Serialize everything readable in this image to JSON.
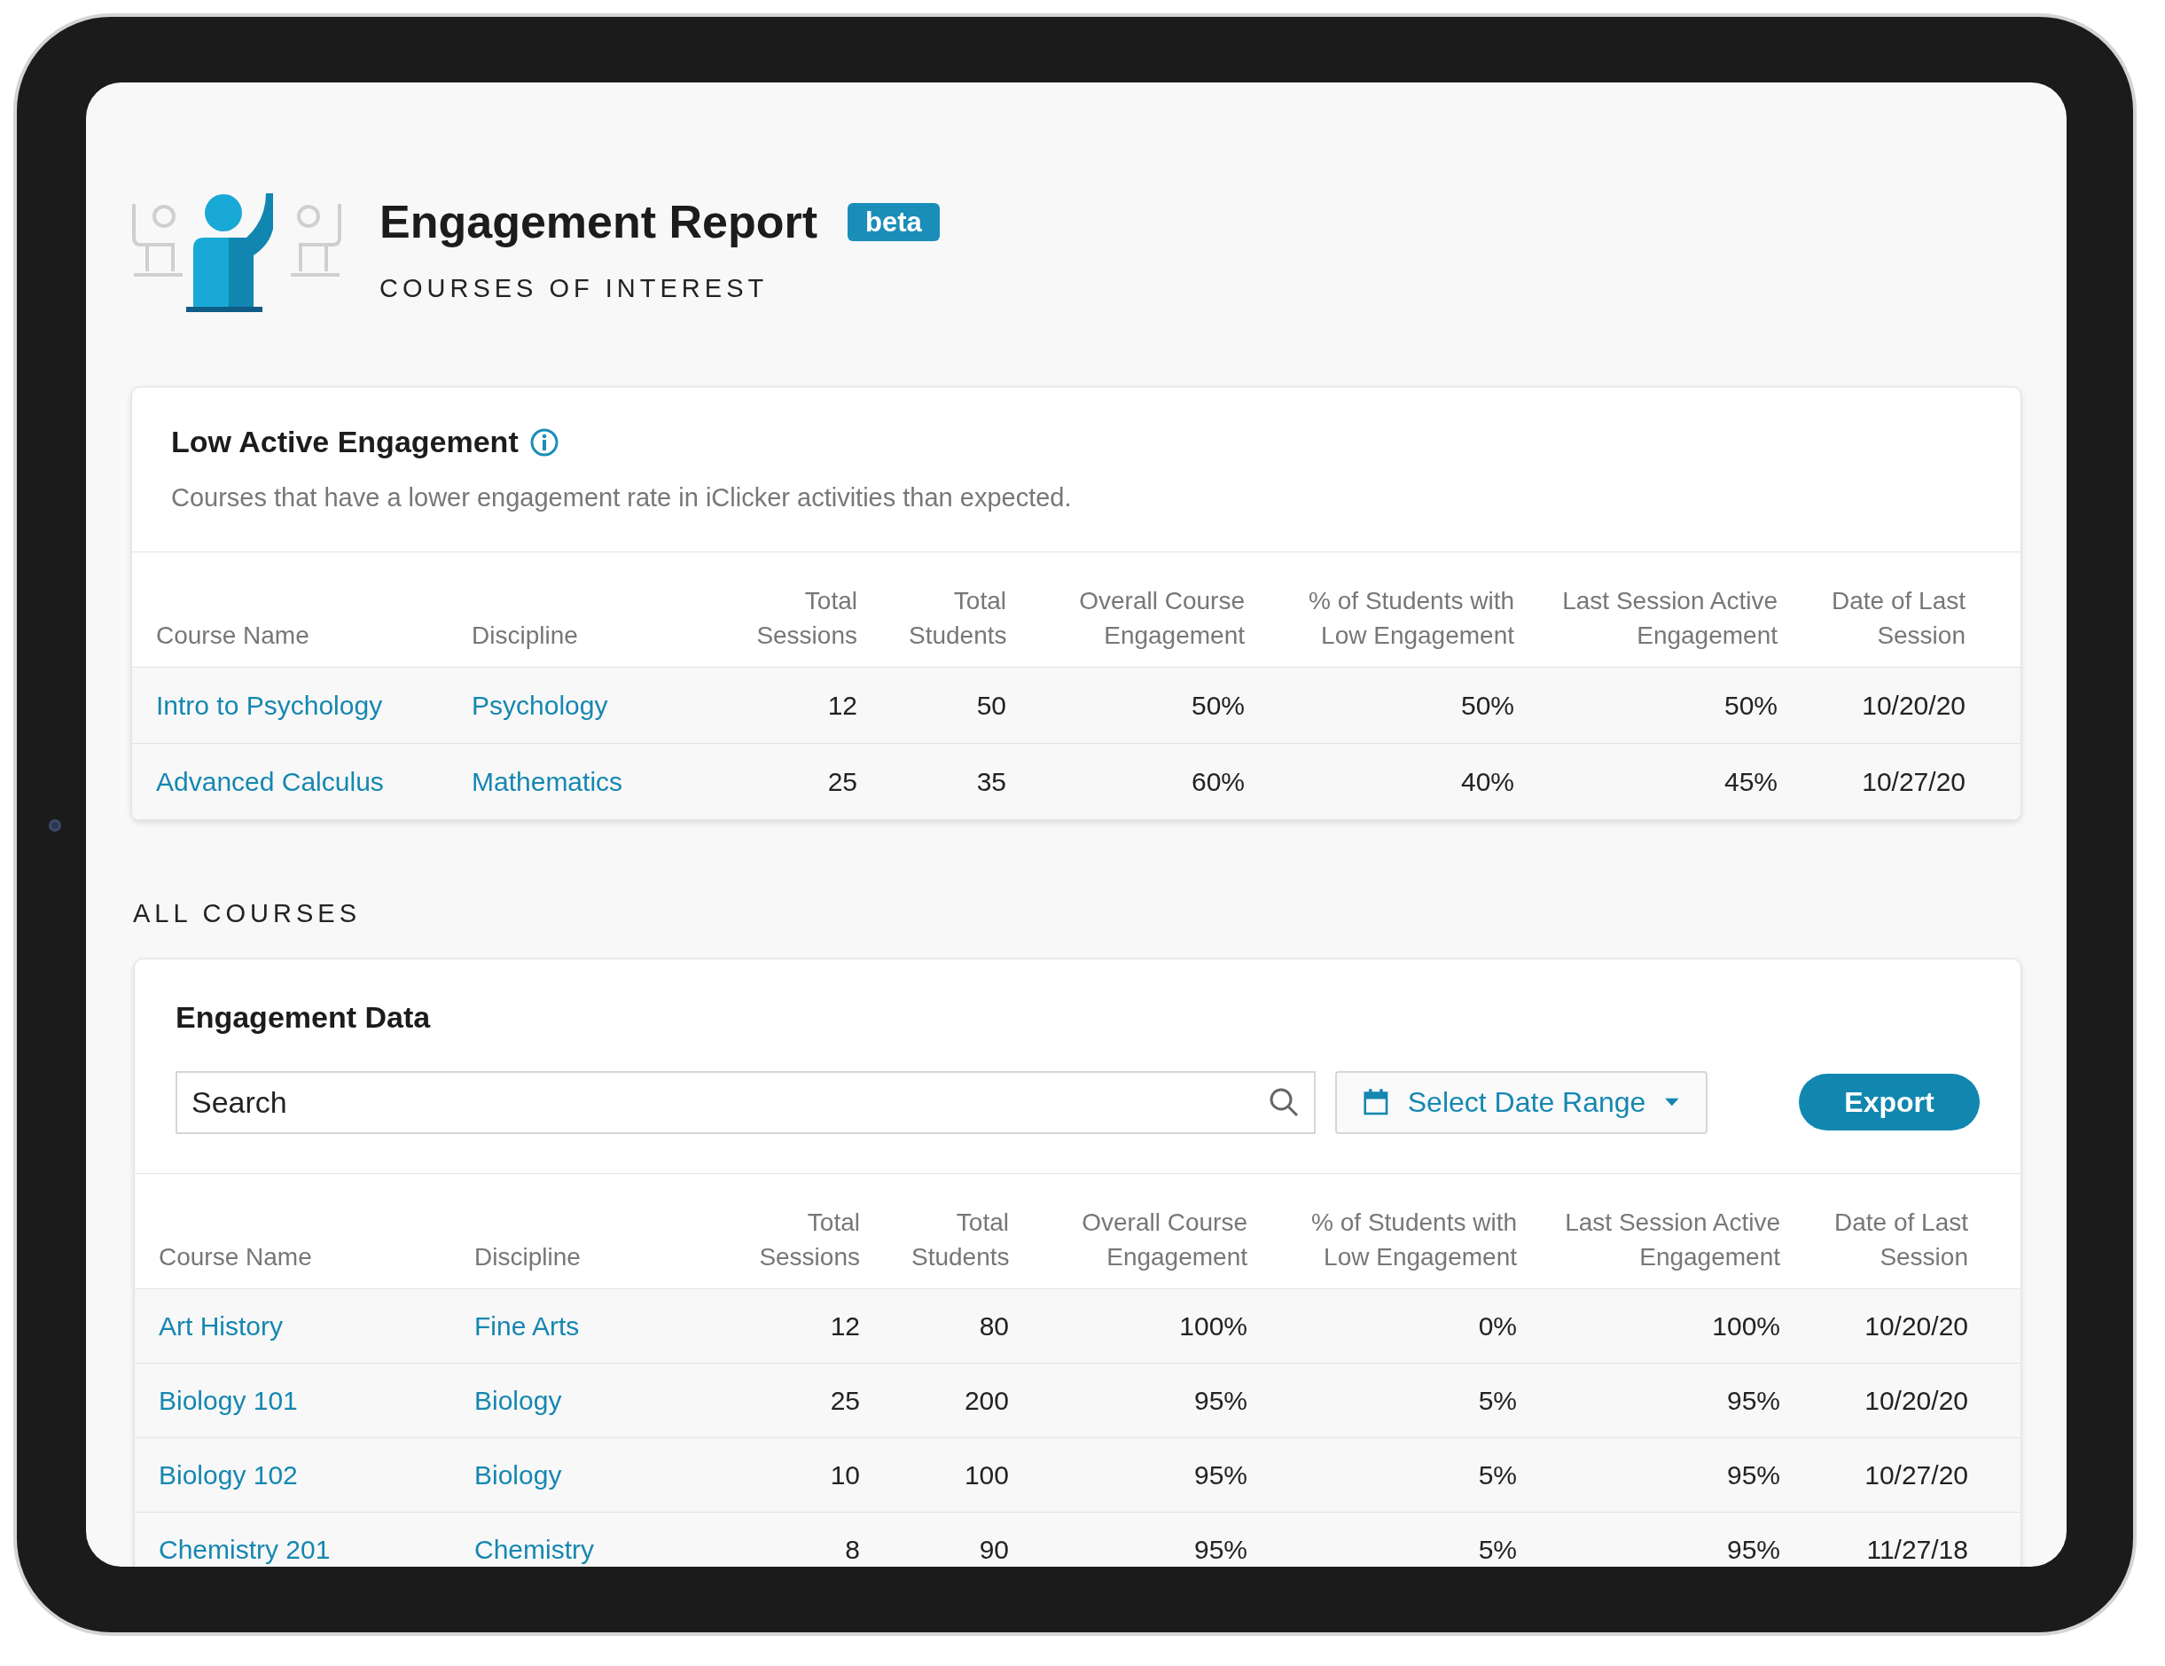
{
  "header": {
    "title": "Engagement Report",
    "badge": "beta",
    "subtitle": "COURSES OF INTEREST"
  },
  "interest_card": {
    "title": "Low Active Engagement",
    "description": "Courses that have a lower engagement rate in iClicker activities than expected.",
    "columns": [
      "Course Name",
      "Discipline",
      "Total Sessions",
      "Total Students",
      "Overall Course Engagement",
      "% of Students with Low Engagement",
      "Last Session Active Engagement",
      "Date of Last Session"
    ],
    "rows": [
      [
        "Intro to Psychology",
        "Psychology",
        "12",
        "50",
        "50%",
        "50%",
        "50%",
        "10/20/20"
      ],
      [
        "Advanced Calculus",
        "Mathematics",
        "25",
        "35",
        "60%",
        "40%",
        "45%",
        "10/27/20"
      ]
    ]
  },
  "section_label": "ALL COURSES",
  "data_card": {
    "title": "Engagement Data",
    "search": {
      "placeholder": "Search"
    },
    "date_range": "Select Date Range",
    "export": "Export",
    "columns": [
      "Course Name",
      "Discipline",
      "Total Sessions",
      "Total Students",
      "Overall Course Engagement",
      "% of Students with Low Engagement",
      "Last Session Active Engagement",
      "Date of Last Session"
    ],
    "rows": [
      [
        "Art History",
        "Fine Arts",
        "12",
        "80",
        "100%",
        "0%",
        "100%",
        "10/20/20"
      ],
      [
        "Biology 101",
        "Biology",
        "25",
        "200",
        "95%",
        "5%",
        "95%",
        "10/20/20"
      ],
      [
        "Biology 102",
        "Biology",
        "10",
        "100",
        "95%",
        "5%",
        "95%",
        "10/27/20"
      ],
      [
        "Chemistry 201",
        "Chemistry",
        "8",
        "90",
        "95%",
        "5%",
        "95%",
        "11/27/18"
      ]
    ]
  }
}
